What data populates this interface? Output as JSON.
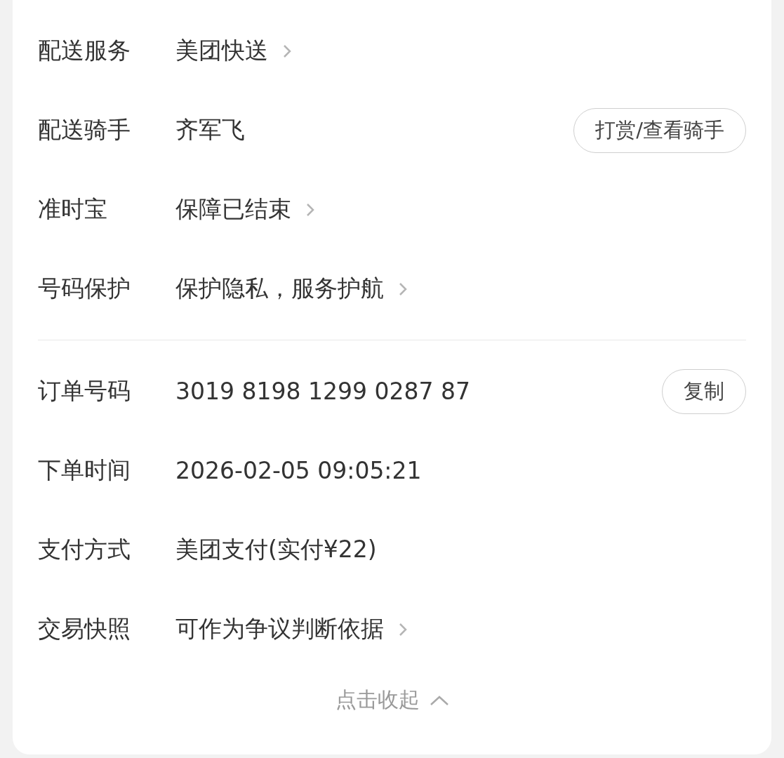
{
  "sections": [
    {
      "rows": [
        {
          "label": "配送服务",
          "value": "美团快送",
          "kind": "link"
        },
        {
          "label": "配送骑手",
          "value": "齐军飞",
          "kind": "button",
          "action": "打赏/查看骑手"
        },
        {
          "label": "准时宝",
          "value": "保障已结束",
          "kind": "link"
        },
        {
          "label": "号码保护",
          "value": "保护隐私，服务护航",
          "kind": "link"
        }
      ]
    },
    {
      "rows": [
        {
          "label": "订单号码",
          "value": "3019 8198 1299 0287 87",
          "kind": "button",
          "action": "复制"
        },
        {
          "label": "下单时间",
          "value": "2026-02-05 09:05:21",
          "kind": "plain"
        },
        {
          "label": "支付方式",
          "value": "美团支付(实付¥22)",
          "kind": "plain"
        },
        {
          "label": "交易快照",
          "value": "可作为争议判断依据",
          "kind": "link"
        }
      ]
    }
  ],
  "collapse": {
    "label": "点击收起"
  }
}
